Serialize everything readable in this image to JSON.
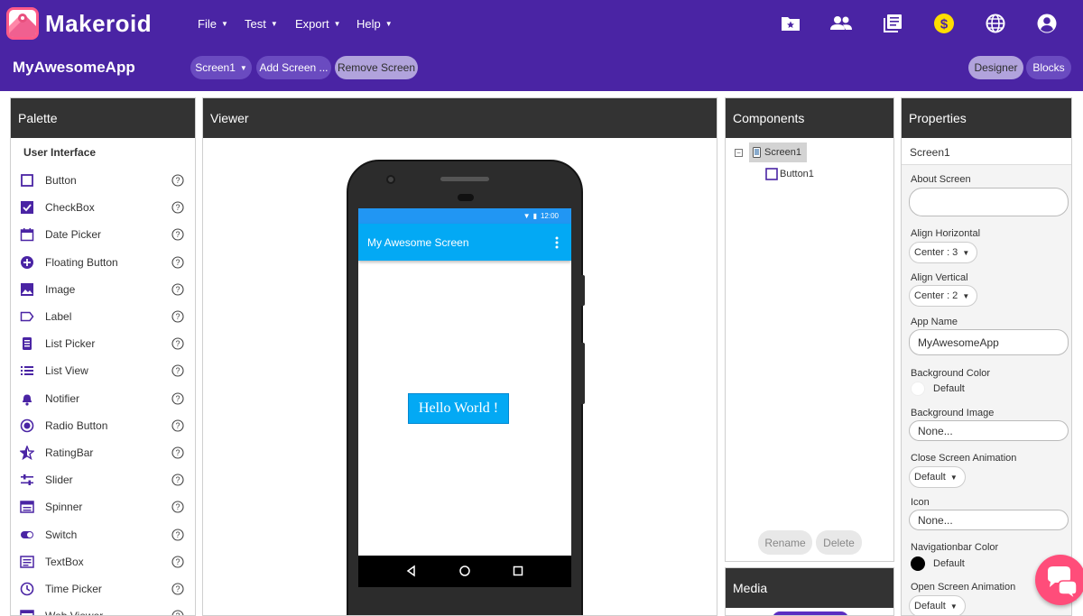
{
  "brand": {
    "name": "Makeroid"
  },
  "menu": [
    {
      "label": "File"
    },
    {
      "label": "Test"
    },
    {
      "label": "Export"
    },
    {
      "label": "Help"
    }
  ],
  "project": {
    "title": "MyAwesomeApp",
    "screen_select": "Screen1",
    "add_screen": "Add Screen ...",
    "remove_screen": "Remove Screen",
    "designer": "Designer",
    "blocks": "Blocks"
  },
  "palette": {
    "title": "Palette",
    "category": "User Interface",
    "items": [
      {
        "label": "Button",
        "icon": "button-icon"
      },
      {
        "label": "CheckBox",
        "icon": "checkbox-icon"
      },
      {
        "label": "Date Picker",
        "icon": "calendar-icon"
      },
      {
        "label": "Floating Button",
        "icon": "plus-circle-icon"
      },
      {
        "label": "Image",
        "icon": "image-icon"
      },
      {
        "label": "Label",
        "icon": "label-icon"
      },
      {
        "label": "List Picker",
        "icon": "list-picker-icon"
      },
      {
        "label": "List View",
        "icon": "list-icon"
      },
      {
        "label": "Notifier",
        "icon": "bell-icon"
      },
      {
        "label": "Radio Button",
        "icon": "radio-icon"
      },
      {
        "label": "RatingBar",
        "icon": "star-icon"
      },
      {
        "label": "Slider",
        "icon": "slider-icon"
      },
      {
        "label": "Spinner",
        "icon": "spinner-icon"
      },
      {
        "label": "Switch",
        "icon": "switch-icon"
      },
      {
        "label": "TextBox",
        "icon": "textbox-icon"
      },
      {
        "label": "Time Picker",
        "icon": "clock-icon"
      },
      {
        "label": "Web Viewer",
        "icon": "web-icon"
      }
    ]
  },
  "viewer": {
    "title": "Viewer",
    "status_time": "12:00",
    "screen_title": "My Awesome Screen",
    "button_text": "Hello World !"
  },
  "components": {
    "title": "Components",
    "screen": "Screen1",
    "child": "Button1",
    "rename": "Rename",
    "delete": "Delete"
  },
  "media": {
    "title": "Media"
  },
  "properties": {
    "title": "Properties",
    "screen": "Screen1",
    "about_screen": "About Screen",
    "align_horizontal": "Align Horizontal",
    "align_horizontal_value": "Center : 3",
    "align_vertical": "Align Vertical",
    "align_vertical_value": "Center : 2",
    "app_name": "App Name",
    "app_name_value": "MyAwesomeApp",
    "background_color": "Background Color",
    "background_color_value": "Default",
    "background_image": "Background Image",
    "background_image_value": "None...",
    "close_anim": "Close Screen Animation",
    "close_anim_value": "Default",
    "icon": "Icon",
    "icon_value": "None...",
    "navbar_color": "Navigationbar Color",
    "navbar_color_value": "Default",
    "open_anim": "Open Screen Animation",
    "open_anim_value": "Default"
  },
  "colors": {
    "topbar": "#4a24a4",
    "accent": "#6a4bc0",
    "app_primary": "#03a9f4",
    "status_bar": "#2196f3",
    "chat": "#ff4d7a"
  }
}
